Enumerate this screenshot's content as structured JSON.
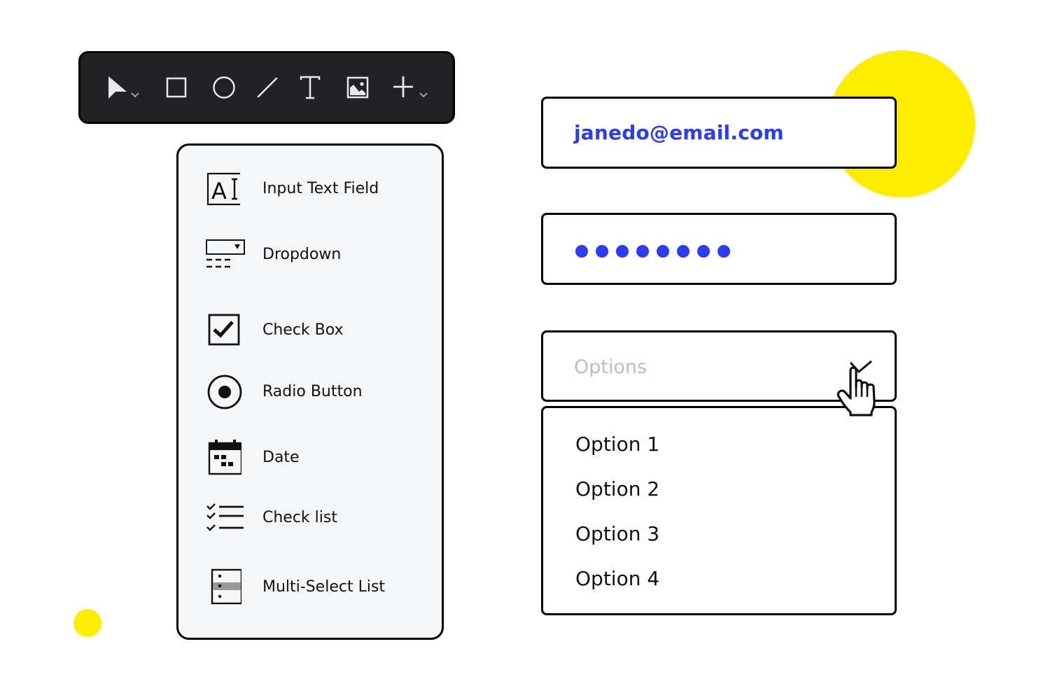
{
  "toolbar": {
    "tools": [
      {
        "icon": "pointer-arrow-icon",
        "label": "Select",
        "has_dropdown": true
      },
      {
        "icon": "rectangle-icon",
        "label": "Rectangle"
      },
      {
        "icon": "ellipse-icon",
        "label": "Ellipse"
      },
      {
        "icon": "line-icon",
        "label": "Line"
      },
      {
        "icon": "text-icon",
        "label": "Text"
      },
      {
        "icon": "image-icon",
        "label": "Image"
      },
      {
        "icon": "plus-icon",
        "label": "Add",
        "has_dropdown": true
      }
    ]
  },
  "components_panel": {
    "items": [
      {
        "icon": "input-text-field-icon",
        "label": "Input Text Field"
      },
      {
        "icon": "dropdown-icon",
        "label": "Dropdown"
      },
      {
        "icon": "checkbox-icon",
        "label": "Check Box"
      },
      {
        "icon": "radio-button-icon",
        "label": "Radio Button"
      },
      {
        "icon": "calendar-icon",
        "label": "Date"
      },
      {
        "icon": "checklist-icon",
        "label": "Check list"
      },
      {
        "icon": "multi-select-list-icon",
        "label": "Multi-Select List"
      }
    ]
  },
  "form": {
    "email": {
      "value": "janedo@email.com"
    },
    "password": {
      "masked_length": 8
    },
    "select": {
      "placeholder": "Options",
      "expanded": true,
      "options": [
        "Option 1",
        "Option 2",
        "Option 3",
        "Option 4"
      ]
    }
  },
  "colors": {
    "accent_blue": "#2B3CF2",
    "highlight_yellow": "#FFEC00",
    "toolbar_bg": "#222224",
    "panel_bg": "#F5F6F7",
    "placeholder_gray": "#B3BFCE"
  }
}
